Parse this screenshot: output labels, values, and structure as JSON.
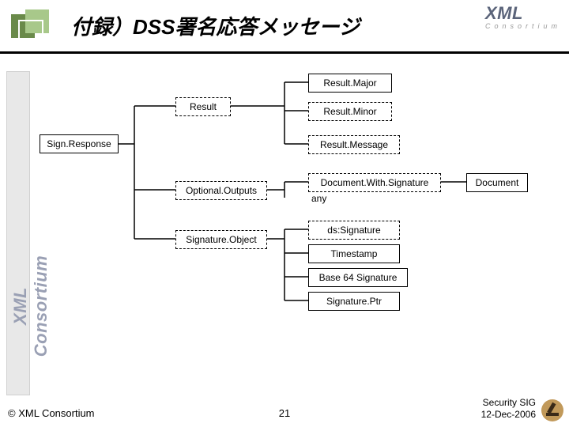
{
  "header": {
    "title": "付録）DSS署名応答メッセージ",
    "logo_main": "XML",
    "logo_sub": "Consortium"
  },
  "sidebar": {
    "text": "XML Consortium"
  },
  "nodes": {
    "sign_response": "Sign.Response",
    "result": "Result",
    "result_major": "Result.Major",
    "result_minor": "Result.Minor",
    "result_message": "Result.Message",
    "optional_outputs": "Optional.Outputs",
    "signature_object": "Signature.Object",
    "document_with_signature": "Document.With.Signature",
    "any_label": "any",
    "document": "Document",
    "ds_signature": "ds:Signature",
    "timestamp": "Timestamp",
    "base64_signature": "Base 64 Signature",
    "signature_ptr": "Signature.Ptr"
  },
  "footer": {
    "copyright": "© XML Consortium",
    "slide_number": "21",
    "line1": "Security SIG",
    "line2": "12-Dec-2006"
  }
}
